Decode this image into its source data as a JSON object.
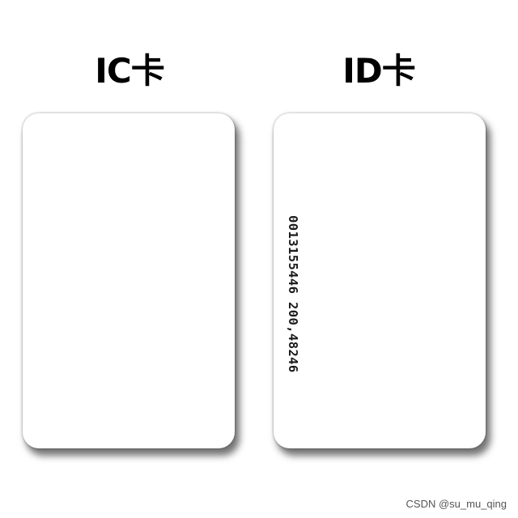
{
  "labels": {
    "ic_card": "IC卡",
    "id_card": "ID卡"
  },
  "id_card_number": "0013155446 200,48246",
  "watermark": "CSDN @su_mu_qing"
}
